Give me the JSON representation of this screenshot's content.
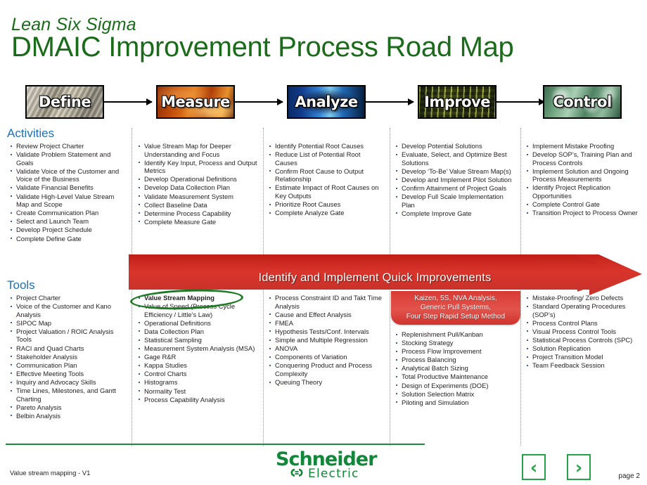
{
  "header": {
    "subtitle": "Lean Six Sigma",
    "title": "DMAIC Improvement Process Road Map"
  },
  "phases": [
    {
      "label": "Define",
      "texture": "tex-define"
    },
    {
      "label": "Measure",
      "texture": "tex-measure"
    },
    {
      "label": "Analyze",
      "texture": "tex-analyze"
    },
    {
      "label": "Improve",
      "texture": "tex-improve"
    },
    {
      "label": "Control",
      "texture": "tex-control"
    }
  ],
  "sections": {
    "activities_heading": "Activities",
    "tools_heading": "Tools"
  },
  "activities": {
    "define": [
      "Review Project Charter",
      "Validate  Problem Statement and Goals",
      "Validate  Voice of the Customer and Voice of the Business",
      "Validate  Financial Benefits",
      "Validate  High-Level Value Stream  Map and Scope",
      "Create Communication  Plan",
      "Select and Launch Team",
      "Develop Project Schedule",
      "Complete Define Gate"
    ],
    "measure": [
      "Value Stream Map for Deeper Understanding and Focus",
      "Identify Key Input, Process and Output Metrics",
      "Develop Operational Definitions",
      "Develop Data Collection  Plan",
      "Validate  Measurement System",
      "Collect Baseline Data",
      "Determine Process Capability",
      "Complete Measure Gate"
    ],
    "analyze": [
      "Identify Potential  Root Causes",
      "Reduce List of Potential Root Causes",
      "Confirm Root Cause to Output Relationship",
      "Estimate  Impact  of  Root Causes on Key Outputs",
      "Prioritize  Root Causes",
      "Complete Analyze Gate"
    ],
    "improve": [
      "Develop Potential Solutions",
      "Evaluate, Select,  and Optimize Best Solutions",
      "Develop ‘To-Be’ Value Stream Map(s)",
      "Develop and Implement Pilot Solution",
      "Confirm Attainment  of Project Goals",
      "Develop Full Scale Implementation  Plan",
      "Complete Improve Gate"
    ],
    "control": [
      "Implement  Mistake  Proofing",
      "Develop SOP’s, Training Plan and Process Controls",
      "Implement  Solution and Ongoing Process Measurements",
      "Identify Project Replication Opportunities",
      "Complete Control Gate",
      "Transition Project to Process Owner"
    ]
  },
  "tools": {
    "define": [
      "Project Charter",
      "Voice of the Customer and Kano Analysis",
      "SIPOC Map",
      "Project Valuation / ROIC Analysis Tools",
      "RACI and Quad Charts",
      "Stakeholder Analysis",
      "Communication  Plan",
      "Effective  Meeting Tools",
      "Inquiry and Advocacy Skills",
      "Time Lines, Milestones, and Gantt Charting",
      "Pareto Analysis",
      "Belbin Analysis"
    ],
    "measure": [
      "Value Stream Mapping",
      "Value of Speed (Process Cycle Efficiency  / Little’s  Law)",
      "Operational Definitions",
      "Data Collection Plan",
      "Statistical   Sampling",
      "Measurement System Analysis (MSA)",
      "Gage R&R",
      "Kappa Studies",
      "Control Charts",
      "Histograms",
      "Normality Test",
      "Process Capability Analysis"
    ],
    "analyze": [
      "Process Constraint ID and Takt Time Analysis",
      "Cause and Effect  Analysis",
      "FMEA",
      "Hypothesis Tests/Conf. Intervals",
      "Simple  and Multiple  Regression",
      "ANOVA",
      "Components of Variation",
      "Conquering Product and Process Complexity",
      "Queuing Theory"
    ],
    "improve": [
      "Replenishment Pull/Kanban",
      "Stocking  Strategy",
      "Process Flow Improvement",
      "Process Balancing",
      "Analytical  Batch Sizing",
      "Total Productive Maintenance",
      "Design of Experiments (DOE)",
      "Solution  Selection Matrix",
      "Piloting  and Simulation"
    ],
    "control": [
      "Mistake-Proofing/ Zero Defects",
      "Standard Operating Procedures (SOP’s)",
      "Process Control Plans",
      "Visual Process Control Tools",
      "Statistical   Process Controls (SPC)",
      "Solution  Replication",
      "Project Transition Model",
      "Team Feedback Session"
    ],
    "highlighted_item": "Value Stream Mapping"
  },
  "banner": {
    "arrow_label": "Identify and Implement Quick Improvements",
    "callout_lines": [
      "Kaizen, 5S, NVA Analysis,",
      "Generic Pull Systems,",
      "Four Step Rapid Setup Method"
    ],
    "arrow_color": "#CE3A33"
  },
  "footer": {
    "note": "Value stream mapping  -  V1",
    "page": "page 2",
    "logo_primary": "Schneider",
    "logo_secondary": "Electric",
    "prev_label": "‹",
    "next_label": "›",
    "brand_green": "#12873A"
  }
}
